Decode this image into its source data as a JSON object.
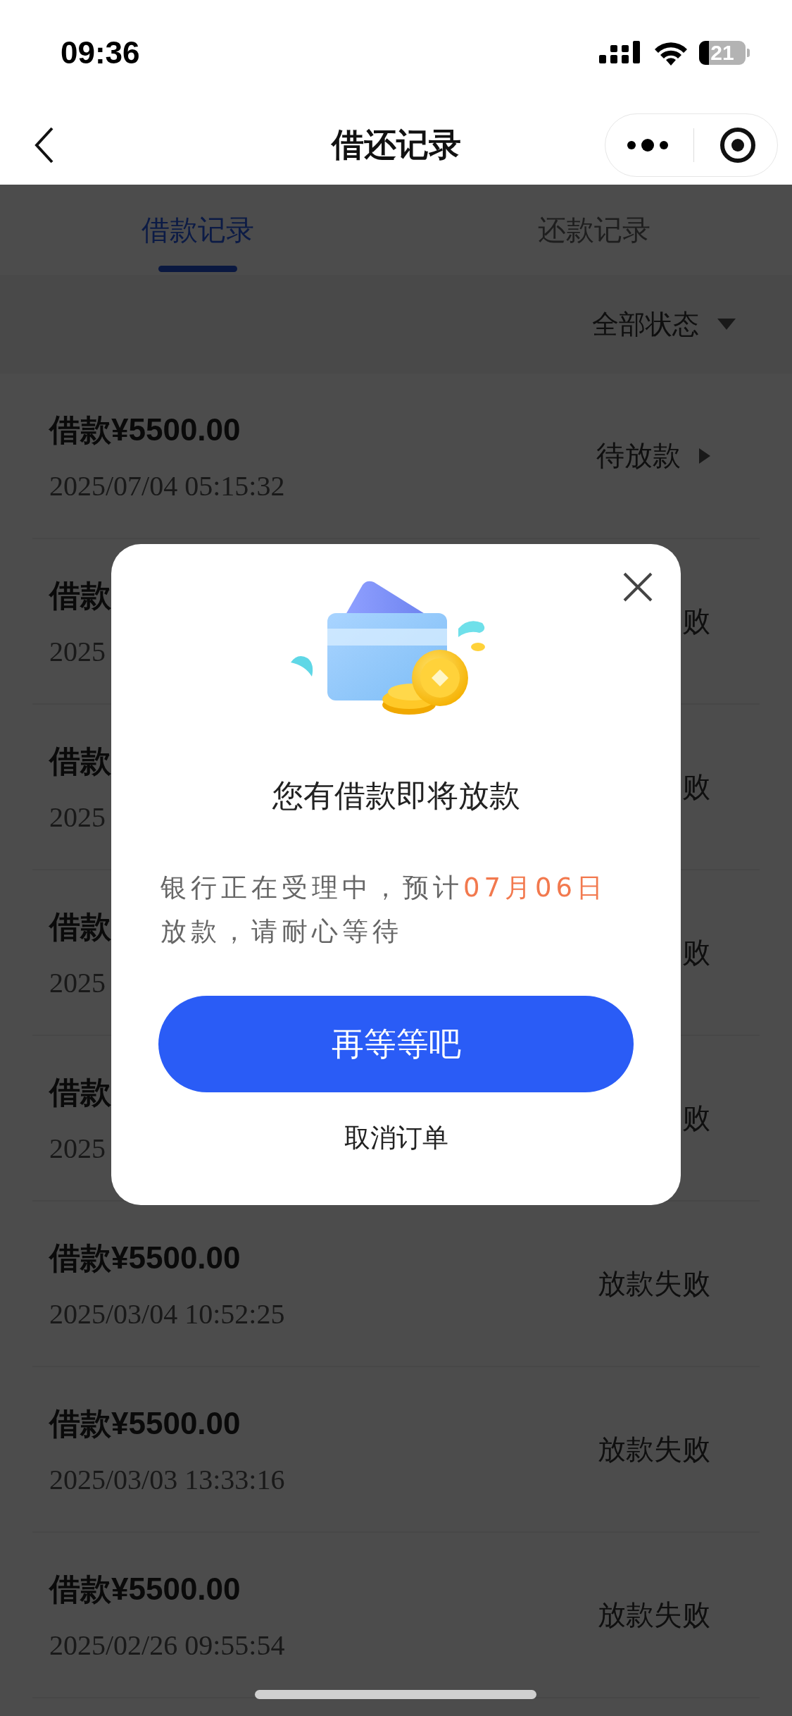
{
  "status_bar": {
    "time": "09:36",
    "battery": "21"
  },
  "nav": {
    "title": "借还记录"
  },
  "tabs": [
    {
      "label": "借款记录",
      "selected": true
    },
    {
      "label": "还款记录",
      "selected": false
    }
  ],
  "filter": {
    "label": "全部状态"
  },
  "records": [
    {
      "kind": "pending",
      "title": "借款¥5500.00",
      "date": "2025/07/04 05:15:32",
      "status": "待放款"
    },
    {
      "kind": "failed",
      "title": "借款",
      "date": "2025",
      "status": "败"
    },
    {
      "kind": "failed",
      "title": "借款",
      "date": "2025",
      "status": "败"
    },
    {
      "kind": "failed",
      "title": "借款",
      "date": "2025",
      "status": "败"
    },
    {
      "kind": "failed",
      "title": "借款",
      "date": "2025",
      "status": "败"
    },
    {
      "kind": "failed",
      "title": "借款¥5500.00",
      "date": "2025/03/04 10:52:25",
      "status": "放款失败"
    },
    {
      "kind": "failed",
      "title": "借款¥5500.00",
      "date": "2025/03/03 13:33:16",
      "status": "放款失败"
    },
    {
      "kind": "failed",
      "title": "借款¥5500.00",
      "date": "2025/02/26 09:55:54",
      "status": "放款失败"
    }
  ],
  "dialog": {
    "title": "您有借款即将放款",
    "message": [
      {
        "text": "银行正在受理中，预计",
        "highlight": false
      },
      {
        "text": "07月06日",
        "highlight": true
      },
      {
        "text": "放款，请耐心等待",
        "highlight": false
      }
    ],
    "primary_button": "再等等吧",
    "secondary_button": "取消订单"
  }
}
